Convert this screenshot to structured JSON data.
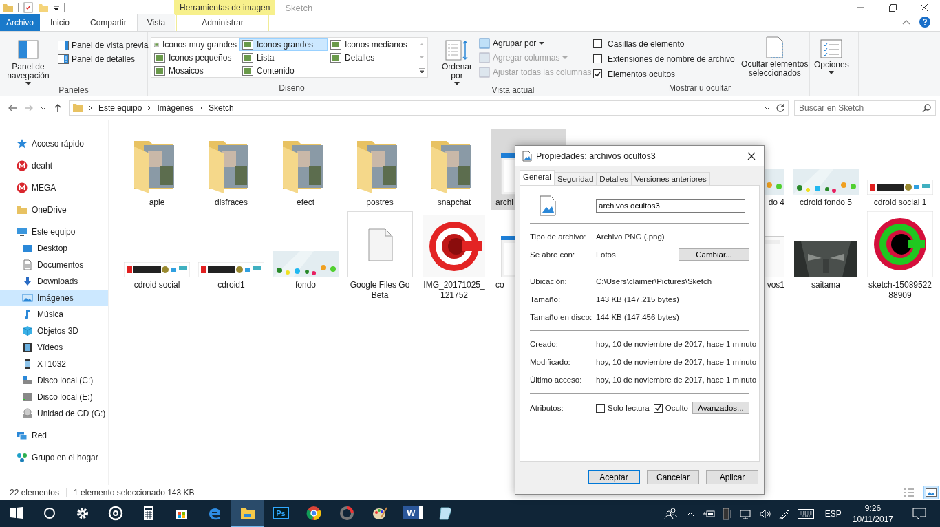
{
  "window": {
    "title": "Sketch",
    "contextual_group": "Herramientas de imagen"
  },
  "ribbon_tabs": [
    {
      "label": "Archivo",
      "kind": "file",
      "selected": false
    },
    {
      "label": "Inicio",
      "kind": "tab",
      "selected": false
    },
    {
      "label": "Compartir",
      "kind": "tab",
      "selected": false
    },
    {
      "label": "Vista",
      "kind": "tab",
      "selected": true
    },
    {
      "label": "Administrar",
      "kind": "contextual",
      "selected": false
    }
  ],
  "ribbon": {
    "panes": {
      "title": "Paneles",
      "navigation_pane": "Panel de navegación",
      "preview_pane": "Panel de vista previa",
      "details_pane": "Panel de detalles"
    },
    "layout": {
      "title": "Diseño",
      "options": [
        {
          "label": "Iconos muy grandes",
          "selected": false
        },
        {
          "label": "Iconos grandes",
          "selected": true
        },
        {
          "label": "Iconos medianos",
          "selected": false
        },
        {
          "label": "Iconos pequeños",
          "selected": false
        },
        {
          "label": "Lista",
          "selected": false
        },
        {
          "label": "Detalles",
          "selected": false
        },
        {
          "label": "Mosaicos",
          "selected": false
        },
        {
          "label": "Contenido",
          "selected": false
        }
      ]
    },
    "current_view": {
      "title": "Vista actual",
      "sort": "Ordenar por",
      "commands": [
        {
          "label": "Agrupar por",
          "dropdown": true,
          "disabled": false
        },
        {
          "label": "Agregar columnas",
          "dropdown": true,
          "disabled": true
        },
        {
          "label": "Ajustar todas las columnas",
          "dropdown": false,
          "disabled": true
        }
      ]
    },
    "show_hide": {
      "title": "Mostrar u ocultar",
      "checkboxes": [
        {
          "label": "Casillas de elemento",
          "checked": false
        },
        {
          "label": "Extensiones de nombre de archivo",
          "checked": false
        },
        {
          "label": "Elementos ocultos",
          "checked": true
        }
      ],
      "hide_selected": "Ocultar elementos seleccionados"
    },
    "options": {
      "label": "Opciones"
    }
  },
  "address_bar": {
    "breadcrumb": [
      "Este equipo",
      "Imágenes",
      "Sketch"
    ],
    "search": {
      "placeholder": "Buscar en Sketch"
    }
  },
  "sidebar": {
    "items": [
      {
        "label": "Acceso rápido",
        "kind": "quick",
        "selected": false
      },
      {
        "label": "deaht",
        "kind": "mega",
        "selected": false
      },
      {
        "label": "MEGA",
        "kind": "mega",
        "selected": false
      },
      {
        "label": "OneDrive",
        "kind": "folder",
        "selected": false
      },
      {
        "label": "Este equipo",
        "kind": "pc",
        "selected": false,
        "children": [
          {
            "label": "Desktop",
            "kind": "desktop",
            "selected": false
          },
          {
            "label": "Documentos",
            "kind": "docs",
            "selected": false
          },
          {
            "label": "Downloads",
            "kind": "download",
            "selected": false
          },
          {
            "label": "Imágenes",
            "kind": "pictures",
            "selected": true
          },
          {
            "label": "Música",
            "kind": "music",
            "selected": false
          },
          {
            "label": "Objetos 3D",
            "kind": "objects",
            "selected": false
          },
          {
            "label": "Vídeos",
            "kind": "videos",
            "selected": false
          },
          {
            "label": "XT1032",
            "kind": "phone",
            "selected": false
          },
          {
            "label": "Disco local (C:)",
            "kind": "system_drive",
            "selected": false
          },
          {
            "label": "Disco local (E:)",
            "kind": "drive",
            "selected": false
          },
          {
            "label": "Unidad de CD (G:)",
            "kind": "cd",
            "selected": false
          }
        ]
      },
      {
        "label": "Red",
        "kind": "network",
        "selected": false
      },
      {
        "label": "Grupo en el hogar",
        "kind": "homegroup",
        "selected": false
      }
    ]
  },
  "files": {
    "rows": [
      [
        {
          "label": "aple",
          "kind": "folder",
          "selected": false
        },
        {
          "label": "disfraces",
          "kind": "folder",
          "selected": false
        },
        {
          "label": "efect",
          "kind": "folder",
          "selected": false
        },
        {
          "label": "postres",
          "kind": "folder",
          "selected": false
        },
        {
          "label": "snapchat",
          "kind": "folder",
          "selected": false
        },
        {
          "label": "archi",
          "kind": "screenshot",
          "selected": true
        },
        {
          "label": "do 4",
          "kind": "dots_banner",
          "selected": false
        },
        {
          "label": "cdroid fondo 5",
          "kind": "dots_banner",
          "selected": false
        },
        {
          "label": "cdroid social 1",
          "kind": "logo_banner",
          "selected": false
        }
      ],
      [
        {
          "label": "cdroid social",
          "kind": "logo_banner",
          "selected": false
        },
        {
          "label": "cdroid1",
          "kind": "logo_banner",
          "selected": false
        },
        {
          "label": "fondo",
          "kind": "dots_banner",
          "selected": false
        },
        {
          "label": "Google Files Go Beta",
          "kind": "document",
          "selected": false
        },
        {
          "label": "IMG_20171025_121752",
          "kind": "ring_logo",
          "selected": false
        },
        {
          "label": "co",
          "kind": "screenshot",
          "selected": false
        },
        {
          "label": "vos1",
          "kind": "blank_image",
          "selected": false
        },
        {
          "label": "saitama",
          "kind": "dark_image",
          "selected": false
        },
        {
          "label": "sketch-1508952288909",
          "kind": "green_ring_logo",
          "selected": false
        }
      ]
    ]
  },
  "status_bar": {
    "count": "22 elementos",
    "selection": "1 elemento seleccionado  143 KB",
    "views": [
      {
        "kind": "details",
        "selected": false
      },
      {
        "kind": "large_icons",
        "selected": true
      }
    ]
  },
  "dialog": {
    "title": "Propiedades: archivos ocultos3",
    "tabs": [
      {
        "label": "General",
        "selected": true
      },
      {
        "label": "Seguridad",
        "selected": false
      },
      {
        "label": "Detalles",
        "selected": false
      },
      {
        "label": "Versiones anteriores",
        "selected": false
      }
    ],
    "file_name": "archivos ocultos3",
    "sections": [
      [
        {
          "label": "Tipo de archivo:",
          "value": "Archivo PNG (.png)"
        },
        {
          "label": "Se abre con:",
          "value": "Fotos",
          "button": "Cambiar..."
        }
      ],
      [
        {
          "label": "Ubicación:",
          "value": "C:\\Users\\claimer\\Pictures\\Sketch"
        },
        {
          "label": "Tamaño:",
          "value": "143 KB (147.215 bytes)"
        },
        {
          "label": "Tamaño en disco:",
          "value": "144 KB (147.456 bytes)"
        }
      ],
      [
        {
          "label": "Creado:",
          "value": "hoy, 10 de noviembre de 2017, hace 1 minuto"
        },
        {
          "label": "Modificado:",
          "value": "hoy, 10 de noviembre de 2017, hace 1 minuto"
        },
        {
          "label": "Último acceso:",
          "value": "hoy, 10 de noviembre de 2017, hace 1 minuto"
        }
      ]
    ],
    "attributes": {
      "label": "Atributos:",
      "checkboxes": [
        {
          "label": "Solo lectura",
          "checked": false
        },
        {
          "label": "Oculto",
          "checked": true
        }
      ],
      "button": "Avanzados..."
    },
    "buttons": [
      {
        "label": "Aceptar",
        "default": true
      },
      {
        "label": "Cancelar",
        "default": false
      },
      {
        "label": "Aplicar",
        "default": false
      }
    ]
  },
  "taskbar": {
    "apps": [
      {
        "kind": "start",
        "active": false
      },
      {
        "kind": "search",
        "active": false
      },
      {
        "kind": "settings",
        "active": false
      },
      {
        "kind": "music",
        "active": false
      },
      {
        "kind": "calculator",
        "active": false
      },
      {
        "kind": "store",
        "active": false
      },
      {
        "kind": "browser",
        "active": false
      },
      {
        "kind": "explorer",
        "active": true
      },
      {
        "kind": "photoshop",
        "label": "Ps",
        "active": false
      },
      {
        "kind": "chrome",
        "active": false
      },
      {
        "kind": "ring",
        "active": false
      },
      {
        "kind": "paint",
        "active": false
      },
      {
        "kind": "word",
        "label": "W",
        "active": false
      },
      {
        "kind": "notes",
        "active": false
      }
    ],
    "language": "ESP",
    "time": "9:26",
    "date": "10/11/2017"
  }
}
